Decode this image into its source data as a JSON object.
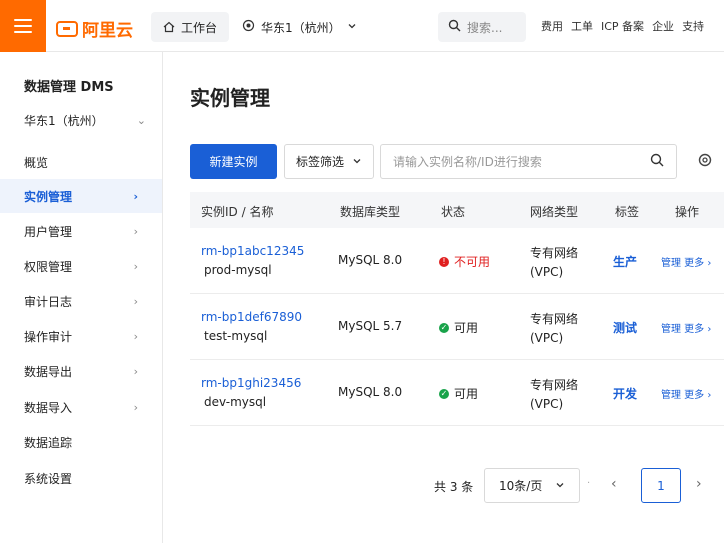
{
  "topbar": {
    "brand": "阿里云",
    "workbench_label": "工作台",
    "region_label": "华东1（杭州）",
    "search_placeholder": "搜索...",
    "links": [
      "费用",
      "工单",
      "ICP 备案",
      "企业",
      "支持"
    ]
  },
  "sidebar": {
    "title": "数据管理 DMS",
    "region": "华东1（杭州）",
    "items": [
      {
        "label": "概览",
        "has_chevron": false,
        "active": false
      },
      {
        "label": "实例管理",
        "has_chevron": true,
        "active": true
      },
      {
        "label": "用户管理",
        "has_chevron": true,
        "active": false
      },
      {
        "label": "权限管理",
        "has_chevron": true,
        "active": false
      },
      {
        "label": "审计日志",
        "has_chevron": true,
        "active": false
      },
      {
        "label": "操作审计",
        "has_chevron": true,
        "active": false
      },
      {
        "label": "数据导出",
        "has_chevron": true,
        "active": false
      },
      {
        "label": "数据导入",
        "has_chevron": true,
        "active": false
      },
      {
        "label": "数据追踪",
        "has_chevron": false,
        "active": false
      },
      {
        "label": "系统设置",
        "has_chevron": false,
        "active": false
      }
    ]
  },
  "main": {
    "title": "实例管理",
    "new_button": "新建实例",
    "tag_filter": "标签筛选",
    "search_placeholder": "请输入实例名称/ID进行搜索",
    "columns": [
      "实例ID / 名称",
      "数据库类型",
      "状态",
      "网络类型",
      "标签",
      "操作"
    ],
    "rows": [
      {
        "id": "rm-bp1abc12345",
        "name": "prod-mysql",
        "db_type": "MySQL 8.0",
        "status": "不可用",
        "status_ok": false,
        "net_line1": "专有网络",
        "net_line2": "(VPC)",
        "tag": "生产",
        "ops": "管理  更多 ›"
      },
      {
        "id": "rm-bp1def67890",
        "name": "test-mysql",
        "db_type": "MySQL 5.7",
        "status": "可用",
        "status_ok": true,
        "net_line1": "专有网络",
        "net_line2": "(VPC)",
        "tag": "测试",
        "ops": "管理  更多 ›"
      },
      {
        "id": "rm-bp1ghi23456",
        "name": "dev-mysql",
        "db_type": "MySQL 8.0",
        "status": "可用",
        "status_ok": true,
        "net_line1": "专有网络",
        "net_line2": "(VPC)",
        "tag": "开发",
        "ops": "管理  更多 ›"
      }
    ]
  },
  "pagination": {
    "total": "共 3 条",
    "page_size": "10条/页",
    "current_page": "1"
  },
  "colors": {
    "brand_orange": "#ff6a00",
    "primary_blue": "#1a5fd6",
    "error_red": "#e02020",
    "success_green": "#19a34a"
  }
}
